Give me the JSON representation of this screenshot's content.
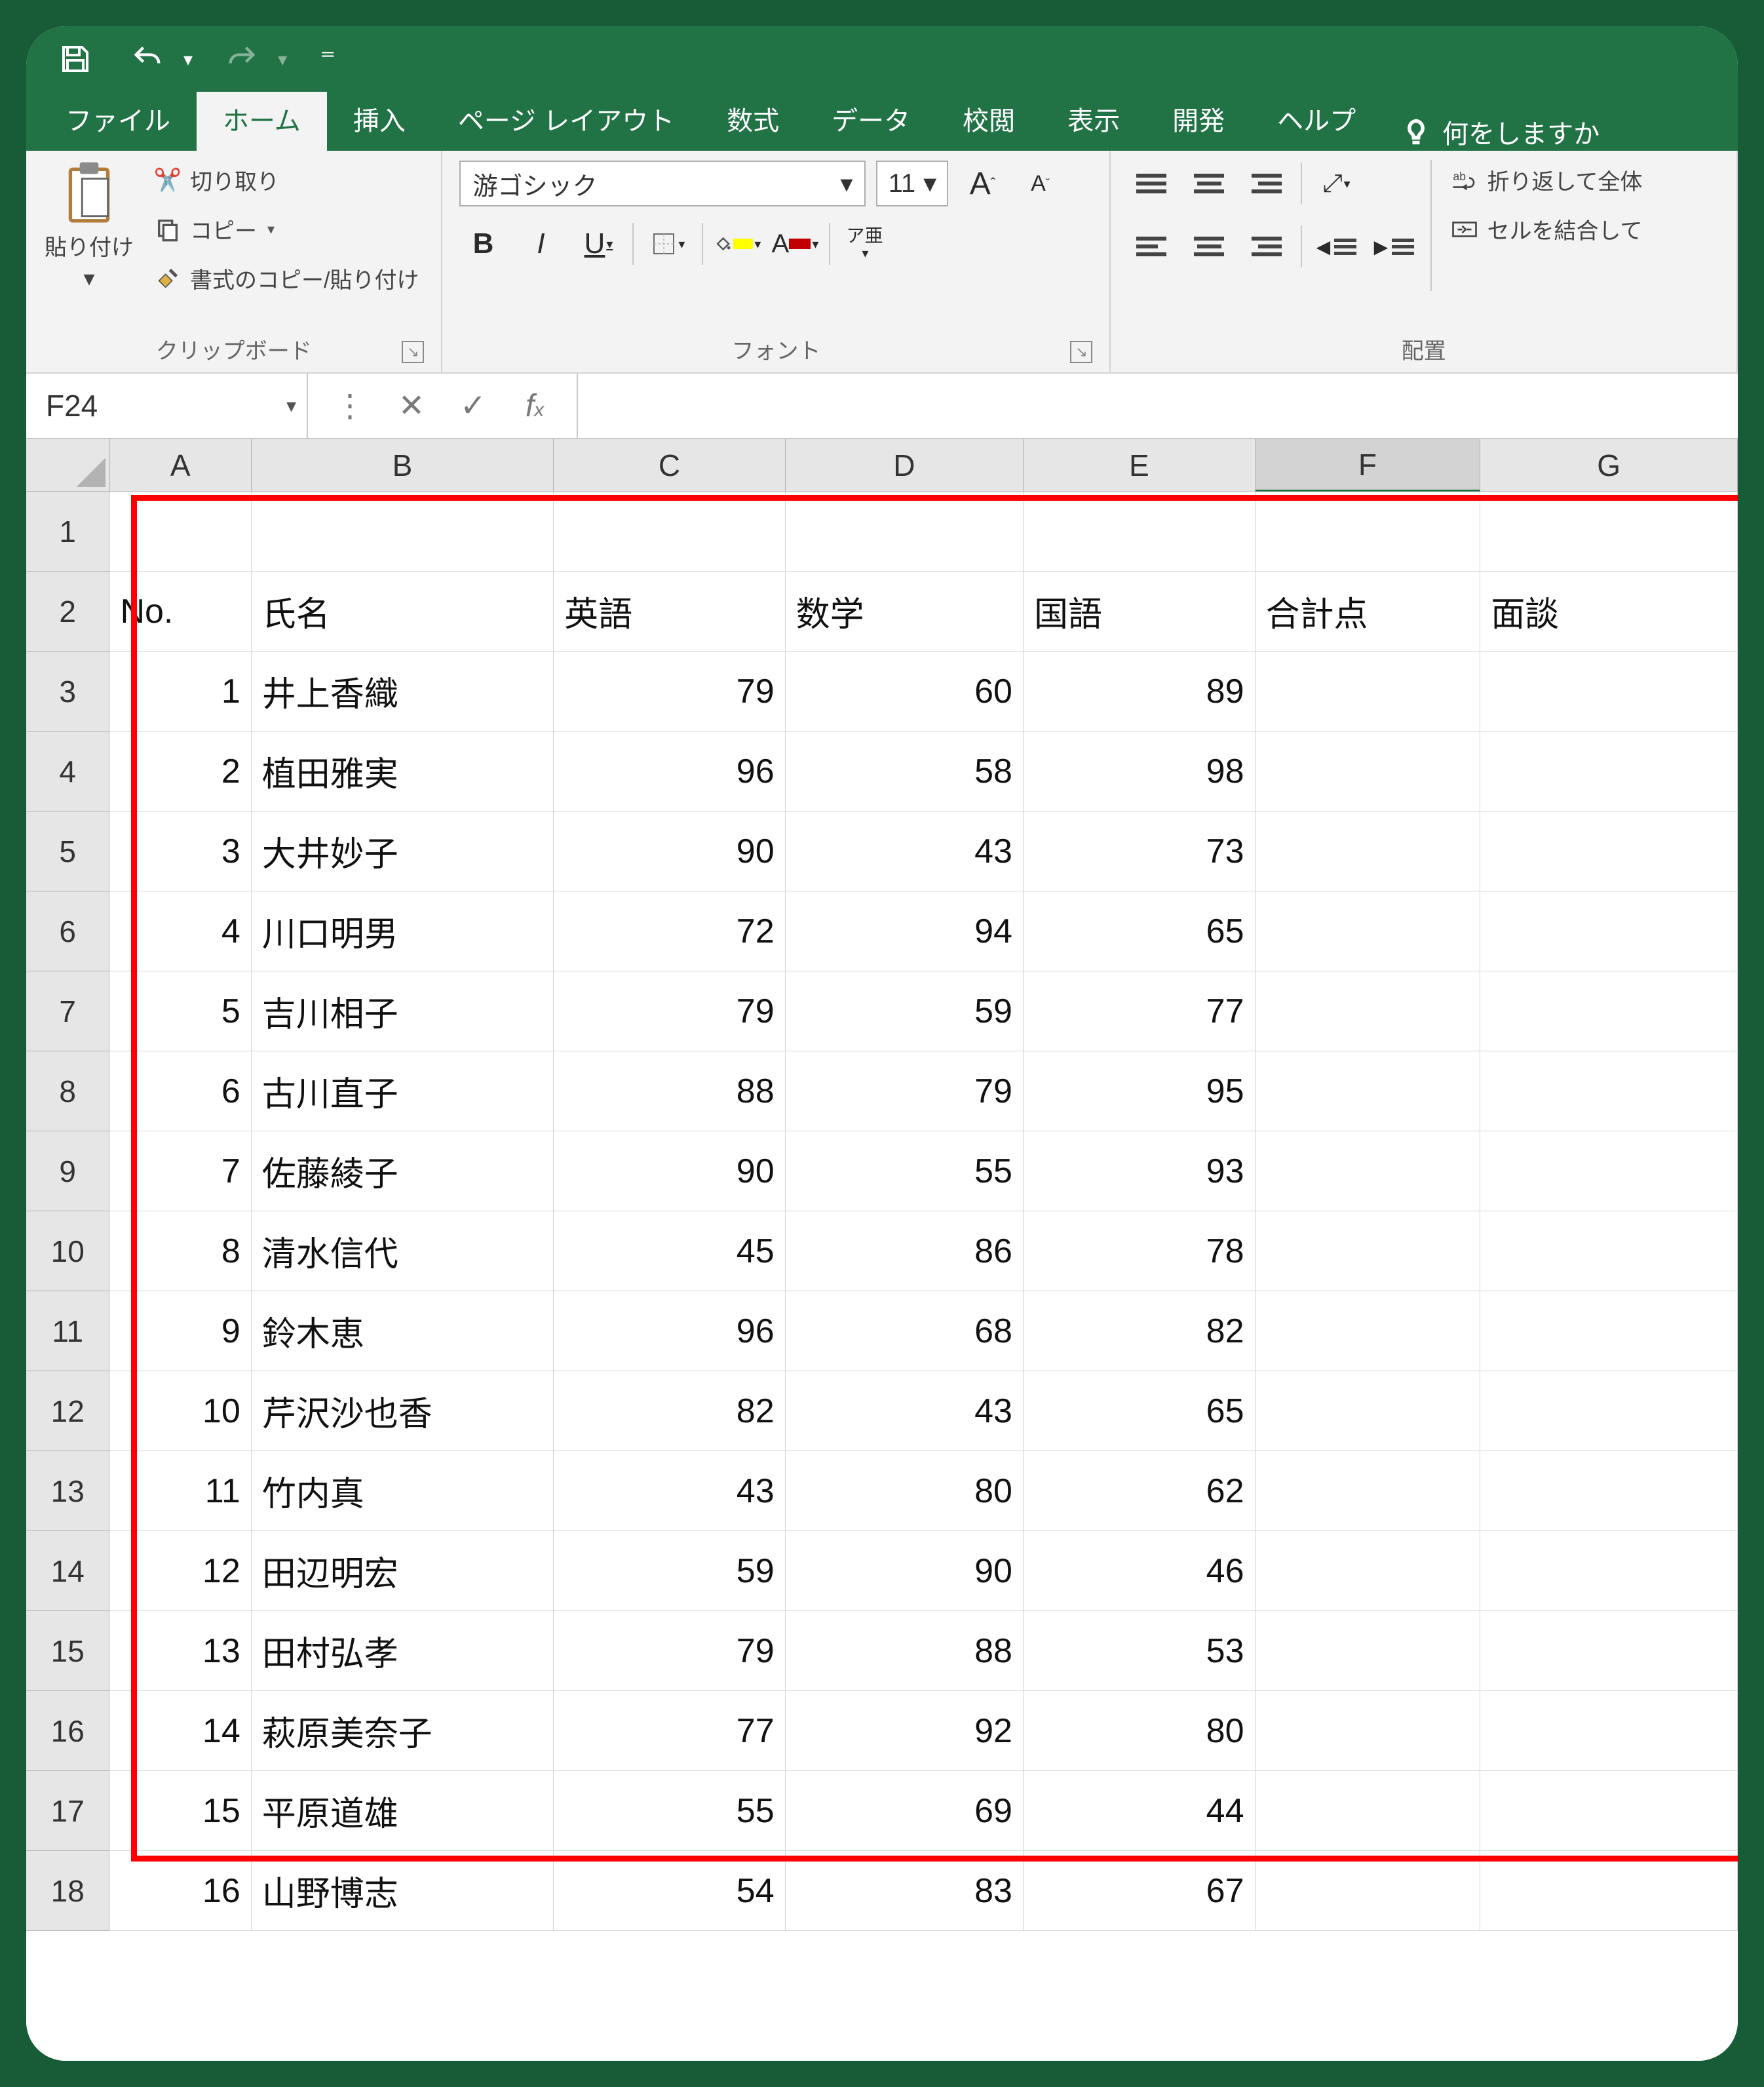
{
  "tabs": {
    "file": "ファイル",
    "home": "ホーム",
    "insert": "挿入",
    "layout": "ページ レイアウト",
    "formula": "数式",
    "data": "データ",
    "review": "校閲",
    "view": "表示",
    "dev": "開発",
    "help": "ヘルプ",
    "tellme": "何をしますか"
  },
  "ribbon": {
    "clipboard": {
      "paste": "貼り付け",
      "cut": "切り取り",
      "copy": "コピー",
      "fmtPainter": "書式のコピー/貼り付け",
      "label": "クリップボード"
    },
    "font": {
      "name": "游ゴシック",
      "size": "11",
      "ruby": "ア亜",
      "label": "フォント"
    },
    "align": {
      "wrap": "折り返して全体",
      "merge": "セルを結合して",
      "label": "配置"
    }
  },
  "formulaBar": {
    "nameBox": "F24",
    "formula": ""
  },
  "columns": [
    "A",
    "B",
    "C",
    "D",
    "E",
    "F",
    "G"
  ],
  "header_row": {
    "A": "No.",
    "B": "氏名",
    "C": "英語",
    "D": "数学",
    "E": "国語",
    "F": "合計点",
    "G": "面談"
  },
  "rows": [
    {
      "no": 1,
      "name": "井上香織",
      "eng": 79,
      "math": 60,
      "jpn": 89
    },
    {
      "no": 2,
      "name": "植田雅実",
      "eng": 96,
      "math": 58,
      "jpn": 98
    },
    {
      "no": 3,
      "name": "大井妙子",
      "eng": 90,
      "math": 43,
      "jpn": 73
    },
    {
      "no": 4,
      "name": "川口明男",
      "eng": 72,
      "math": 94,
      "jpn": 65
    },
    {
      "no": 5,
      "name": "吉川相子",
      "eng": 79,
      "math": 59,
      "jpn": 77
    },
    {
      "no": 6,
      "name": "古川直子",
      "eng": 88,
      "math": 79,
      "jpn": 95
    },
    {
      "no": 7,
      "name": "佐藤綾子",
      "eng": 90,
      "math": 55,
      "jpn": 93
    },
    {
      "no": 8,
      "name": "清水信代",
      "eng": 45,
      "math": 86,
      "jpn": 78
    },
    {
      "no": 9,
      "name": "鈴木恵",
      "eng": 96,
      "math": 68,
      "jpn": 82
    },
    {
      "no": 10,
      "name": "芹沢沙也香",
      "eng": 82,
      "math": 43,
      "jpn": 65
    },
    {
      "no": 11,
      "name": "竹内真",
      "eng": 43,
      "math": 80,
      "jpn": 62
    },
    {
      "no": 12,
      "name": "田辺明宏",
      "eng": 59,
      "math": 90,
      "jpn": 46
    },
    {
      "no": 13,
      "name": "田村弘孝",
      "eng": 79,
      "math": 88,
      "jpn": 53
    },
    {
      "no": 14,
      "name": "萩原美奈子",
      "eng": 77,
      "math": 92,
      "jpn": 80
    },
    {
      "no": 15,
      "name": "平原道雄",
      "eng": 55,
      "math": 69,
      "jpn": 44
    },
    {
      "no": 16,
      "name": "山野博志",
      "eng": 54,
      "math": 83,
      "jpn": 67
    }
  ],
  "chart_data": {
    "type": "table",
    "title": "",
    "columns": [
      "No.",
      "氏名",
      "英語",
      "数学",
      "国語",
      "合計点",
      "面談"
    ],
    "data": [
      [
        1,
        "井上香織",
        79,
        60,
        89,
        null,
        null
      ],
      [
        2,
        "植田雅実",
        96,
        58,
        98,
        null,
        null
      ],
      [
        3,
        "大井妙子",
        90,
        43,
        73,
        null,
        null
      ],
      [
        4,
        "川口明男",
        72,
        94,
        65,
        null,
        null
      ],
      [
        5,
        "吉川相子",
        79,
        59,
        77,
        null,
        null
      ],
      [
        6,
        "古川直子",
        88,
        79,
        95,
        null,
        null
      ],
      [
        7,
        "佐藤綾子",
        90,
        55,
        93,
        null,
        null
      ],
      [
        8,
        "清水信代",
        45,
        86,
        78,
        null,
        null
      ],
      [
        9,
        "鈴木恵",
        96,
        68,
        82,
        null,
        null
      ],
      [
        10,
        "芹沢沙也香",
        82,
        43,
        65,
        null,
        null
      ],
      [
        11,
        "竹内真",
        43,
        80,
        62,
        null,
        null
      ],
      [
        12,
        "田辺明宏",
        59,
        90,
        46,
        null,
        null
      ],
      [
        13,
        "田村弘孝",
        79,
        88,
        53,
        null,
        null
      ],
      [
        14,
        "萩原美奈子",
        77,
        92,
        80,
        null,
        null
      ],
      [
        15,
        "平原道雄",
        55,
        69,
        44,
        null,
        null
      ],
      [
        16,
        "山野博志",
        54,
        83,
        67,
        null,
        null
      ]
    ]
  }
}
